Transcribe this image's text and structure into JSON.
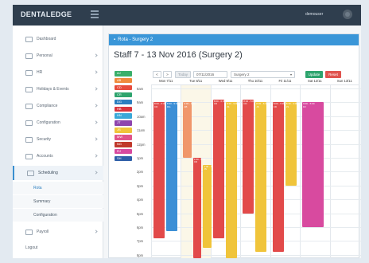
{
  "app": {
    "brand": "DENTALEDGE",
    "user": "demouser"
  },
  "sidebar": {
    "items": [
      {
        "label": "Dashboard",
        "chevron": false
      },
      {
        "label": "Personal",
        "chevron": true
      },
      {
        "label": "HR",
        "chevron": true
      },
      {
        "label": "Holidays & Events",
        "chevron": true
      },
      {
        "label": "Compliance",
        "chevron": true
      },
      {
        "label": "Configuration",
        "chevron": true
      },
      {
        "label": "Security",
        "chevron": true
      },
      {
        "label": "Accounts",
        "chevron": true
      },
      {
        "label": "Scheduling",
        "chevron": true
      }
    ],
    "sub_items": [
      "Rota",
      "Summary",
      "Configuration"
    ],
    "bottom_items": [
      "Payroll",
      "Logout"
    ]
  },
  "panel": {
    "header": "Rota - Surgery 2",
    "title": "Staff  7 - 13 Nov 2016 (Surgery 2)"
  },
  "controls": {
    "prev": "<",
    "next": ">",
    "today": "Today",
    "date_value": "07/11/2016",
    "surgery_value": "Surgery 2",
    "update": "Update",
    "reset": "Reset"
  },
  "staff_legend": [
    {
      "code": "AJ",
      "color": "#3aaf6a"
    },
    {
      "code": "AB",
      "color": "#f08a3c"
    },
    {
      "code": "CD",
      "color": "#e74c3c"
    },
    {
      "code": "CR",
      "color": "#2ea46e"
    },
    {
      "code": "DG",
      "color": "#2c7fc0"
    },
    {
      "code": "HB",
      "color": "#d9363e"
    },
    {
      "code": "HN",
      "color": "#3aa8d8"
    },
    {
      "code": "JT",
      "color": "#8e44ad"
    },
    {
      "code": "JS",
      "color": "#f0c43a"
    },
    {
      "code": "MW",
      "color": "#e0548a"
    },
    {
      "code": "NG",
      "color": "#c0392b"
    },
    {
      "code": "RJ",
      "color": "#d84a9f"
    },
    {
      "code": "SH",
      "color": "#2f5fa8"
    }
  ],
  "days": [
    "Mon 7/11",
    "Tue 8/11",
    "Wed 9/11",
    "Thu 10/11",
    "Fri 11/11",
    "Sat 12/11",
    "Sun 13/11"
  ],
  "hours": [
    "8am",
    "9am",
    "10am",
    "11am",
    "12pm",
    "1pm",
    "2pm",
    "3pm",
    "4pm",
    "5pm",
    "6pm",
    "7pm",
    "8pm"
  ],
  "shifts": [
    {
      "day": 0,
      "start": 9.0,
      "end": 18.8,
      "color": "#e24a4a",
      "label": "8:00 - 6:30\nCD"
    },
    {
      "day": 0,
      "start": 9.0,
      "end": 18.3,
      "color": "#3c8fd6",
      "label": "8:30 - 5:30\nDG"
    },
    {
      "day": 1,
      "start": 9.0,
      "end": 13.0,
      "color": "#f0966a",
      "label": "9:00 - 1:00\nAB"
    },
    {
      "day": 1,
      "start": 13.0,
      "end": 21.0,
      "color": "#e24a4a",
      "label": "1:00 - 9:00\nCD"
    },
    {
      "day": 1,
      "start": 13.5,
      "end": 19.5,
      "color": "#f0c43a",
      "label": "1:30 - 7:30\nJS"
    },
    {
      "day": 2,
      "start": 8.8,
      "end": 18.8,
      "color": "#e24a4a",
      "label": "8:00 - 6:30\nCD"
    },
    {
      "day": 2,
      "start": 9.0,
      "end": 21.0,
      "color": "#f0c43a",
      "label": "8:30 - 9:00\nJS"
    },
    {
      "day": 3,
      "start": 8.8,
      "end": 17.0,
      "color": "#e24a4a",
      "label": "8:00 - 5:00\nCD"
    },
    {
      "day": 3,
      "start": 9.0,
      "end": 19.8,
      "color": "#f0c43a",
      "label": "8:30 - 6:30\nJS"
    },
    {
      "day": 4,
      "start": 9.0,
      "end": 19.8,
      "color": "#e24a4a",
      "label": "8:00 - 6:30\nCD"
    },
    {
      "day": 4,
      "start": 9.0,
      "end": 15.0,
      "color": "#f0c43a",
      "label": "8:30 - 3:00\nJS"
    },
    {
      "day": 5,
      "start": 9.0,
      "end": 18.0,
      "color": "#d84a9f",
      "label": "9:00 - 5:00\nRJ"
    }
  ]
}
